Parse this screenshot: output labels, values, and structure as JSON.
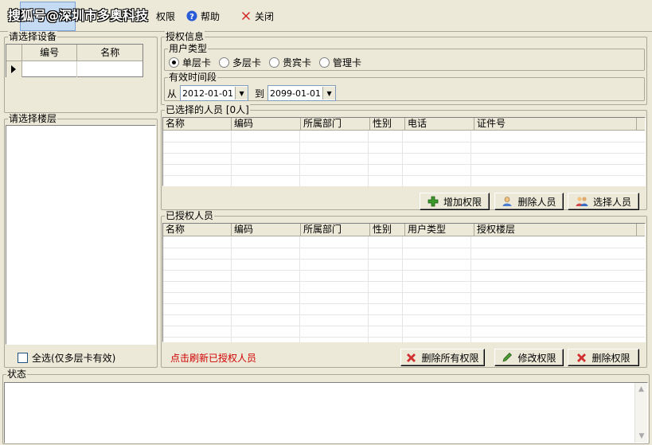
{
  "watermark": "搜狐号@深圳市多奥科技",
  "toolbar": {
    "authorize_label": "权限",
    "help_label": "帮助",
    "close_label": "关闭"
  },
  "device_panel": {
    "title": "请选择设备",
    "columns": [
      "编号",
      "名称"
    ]
  },
  "floor_panel": {
    "title": "请选择楼层",
    "select_all_label": "全选(仅多层卡有效)"
  },
  "auth_info": {
    "title": "授权信息",
    "user_type_title": "用户类型",
    "user_types": [
      "单层卡",
      "多层卡",
      "贵宾卡",
      "管理卡"
    ],
    "selected_user_type": "单层卡",
    "validity_title": "有效时间段",
    "from_label": "从",
    "to_label": "到",
    "start_date": "2012-01-01",
    "end_date": "2099-01-01"
  },
  "selected_people": {
    "title": "已选择的人员 [0人]",
    "columns": [
      "名称",
      "编码",
      "所属部门",
      "性别",
      "电话",
      "证件号"
    ],
    "add_permission_label": "增加权限",
    "delete_person_label": "删除人员",
    "select_person_label": "选择人员"
  },
  "authorized_people": {
    "title": "已授权人员",
    "columns": [
      "名称",
      "编码",
      "所属部门",
      "性别",
      "用户类型",
      "授权楼层"
    ],
    "refresh_link": "点击刷新已授权人员",
    "delete_all_label": "删除所有权限",
    "modify_label": "修改权限",
    "delete_label": "删除权限"
  },
  "status_panel": {
    "title": "状态"
  },
  "colors": {
    "window_bg": "#ece9d8",
    "refresh_link": "#d00000"
  }
}
